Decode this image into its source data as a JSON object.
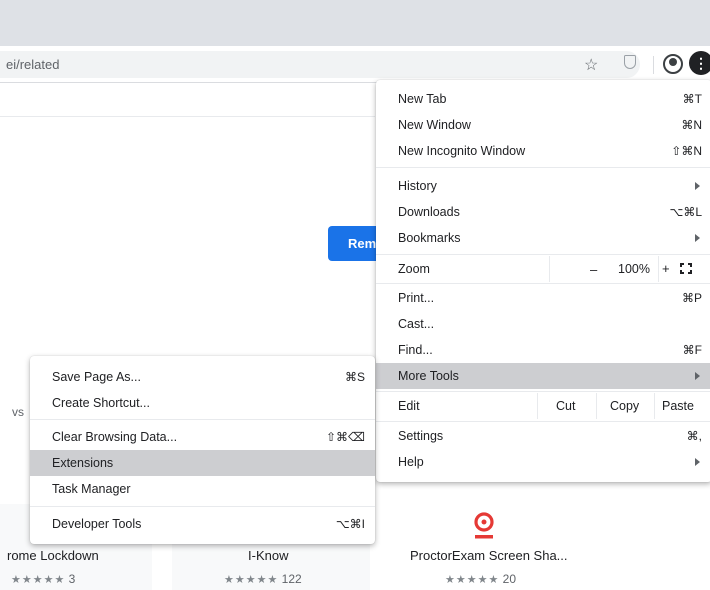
{
  "omnibox": {
    "url_fragment": "ei/related"
  },
  "toolbar": {
    "star_icon": "star-icon",
    "extension_icon": "shield-icon",
    "account_icon": "account-icon",
    "menu_icon": "kebab-icon",
    "menu_glyph": "⋮"
  },
  "page": {
    "remove_button": "Rem",
    "partial_text": "vs",
    "cards": [
      {
        "title": "rome Lockdown",
        "stars": "★★★★★",
        "count": "3"
      },
      {
        "title": "I-Know",
        "stars": "★★★★★",
        "count": "122"
      },
      {
        "title": "ProctorExam Screen Sha...",
        "stars": "★★★★★",
        "count": "20"
      }
    ]
  },
  "main_menu": {
    "new_tab": {
      "label": "New Tab",
      "shortcut": "⌘T"
    },
    "new_window": {
      "label": "New Window",
      "shortcut": "⌘N"
    },
    "incognito": {
      "label": "New Incognito Window",
      "shortcut": "⇧⌘N"
    },
    "history": {
      "label": "History"
    },
    "downloads": {
      "label": "Downloads",
      "shortcut": "⌥⌘L"
    },
    "bookmarks": {
      "label": "Bookmarks"
    },
    "zoom": {
      "label": "Zoom",
      "minus": "–",
      "level": "100%",
      "plus": "+"
    },
    "print": {
      "label": "Print...",
      "shortcut": "⌘P"
    },
    "cast": {
      "label": "Cast..."
    },
    "find": {
      "label": "Find...",
      "shortcut": "⌘F"
    },
    "more_tools": {
      "label": "More Tools"
    },
    "edit": {
      "label": "Edit",
      "cut": "Cut",
      "copy": "Copy",
      "paste": "Paste"
    },
    "settings": {
      "label": "Settings",
      "shortcut": "⌘,"
    },
    "help": {
      "label": "Help"
    }
  },
  "sub_menu": {
    "save_page": {
      "label": "Save Page As...",
      "shortcut": "⌘S"
    },
    "create_shortcut": {
      "label": "Create Shortcut..."
    },
    "clear_data": {
      "label": "Clear Browsing Data...",
      "shortcut": "⇧⌘⌫"
    },
    "extensions": {
      "label": "Extensions"
    },
    "task_manager": {
      "label": "Task Manager"
    },
    "dev_tools": {
      "label": "Developer Tools",
      "shortcut": "⌥⌘I"
    }
  },
  "colors": {
    "accent_blue": "#1a73e8",
    "highlight": "#cdced1",
    "proctor_red": "#e53935"
  }
}
